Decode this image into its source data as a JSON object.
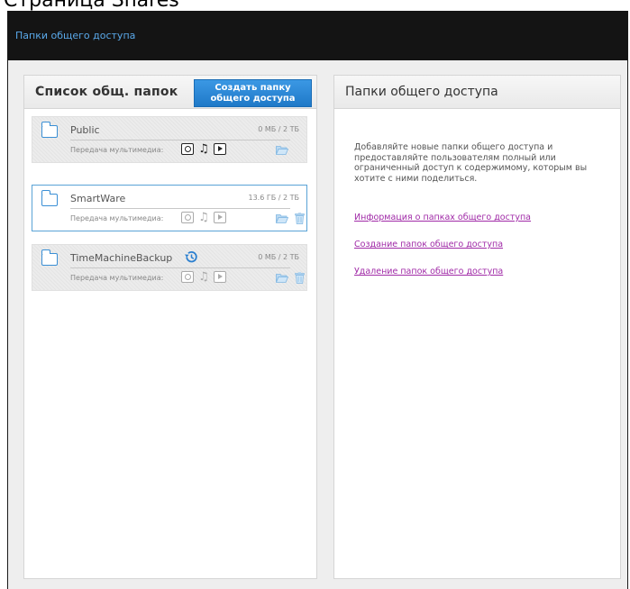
{
  "header": {
    "title": "Папки общего доступа"
  },
  "top_cut_text": "Страница Shares",
  "left_panel": {
    "title": "Список общ. папок",
    "create_button": "Создать папку\nобщего доступа",
    "shares": [
      {
        "name": "Public",
        "size": "0 МБ / 2 ТБ",
        "media_label": "Передача мультимедиа:",
        "media_enabled": true,
        "selected": false,
        "deletable": false,
        "time_machine": false
      },
      {
        "name": "SmartWare",
        "size": "13.6 ГБ / 2 ТБ",
        "media_label": "Передача мультимедиа:",
        "media_enabled": false,
        "selected": true,
        "deletable": true,
        "time_machine": false
      },
      {
        "name": "TimeMachineBackup",
        "size": "0 МБ / 2 ТБ",
        "media_label": "Передача мультимедиа:",
        "media_enabled": false,
        "selected": false,
        "deletable": true,
        "time_machine": true
      }
    ]
  },
  "right_panel": {
    "title": "Папки общего доступа",
    "description": "Добавляйте новые папки общего доступа и предоставляйте пользователям полный или ограниченный доступ к содержимому, которым вы хотите с ними поделиться.",
    "links": [
      "Информация о папках общего доступа",
      "Создание папок общего доступа",
      "Удаление папок общего доступа"
    ]
  },
  "colors": {
    "header_bg": "#141414",
    "accent": "#1f79c8",
    "link": "#a02aa7"
  }
}
